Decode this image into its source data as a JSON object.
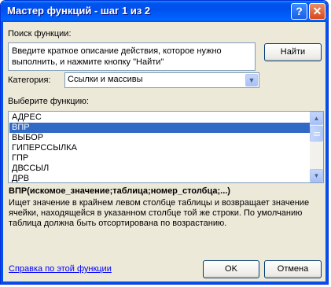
{
  "window": {
    "title": "Мастер функций - шаг 1 из 2",
    "help_button": "?",
    "close_button": "✕"
  },
  "search": {
    "label": "Поиск функции:",
    "value": "Введите краткое описание действия, которое нужно выполнить, и нажмите кнопку \"Найти\"",
    "find_button": "Найти"
  },
  "category": {
    "label": "Категория:",
    "selected": "Ссылки и массивы"
  },
  "functions": {
    "label": "Выберите функцию:",
    "items": [
      "АДРЕС",
      "ВПР",
      "ВЫБОР",
      "ГИПЕРССЫЛКА",
      "ГПР",
      "ДВССЫЛ",
      "ДРВ"
    ],
    "selected": "ВПР"
  },
  "details": {
    "syntax": "ВПР(искомое_значение;таблица;номер_столбца;...)",
    "description": "Ищет значение в крайнем левом столбце таблицы и возвращает значение ячейки, находящейся в указанном столбце той же строки. По умолчанию таблица должна быть отсортирована по возрастанию."
  },
  "footer": {
    "help_link": "Справка по этой функции",
    "ok_button": "OK",
    "cancel_button": "Отмена"
  },
  "colors": {
    "titlebar": "#0054e3",
    "dialog_bg": "#ece9d8",
    "selection": "#316ac5",
    "link": "#0000ff"
  }
}
